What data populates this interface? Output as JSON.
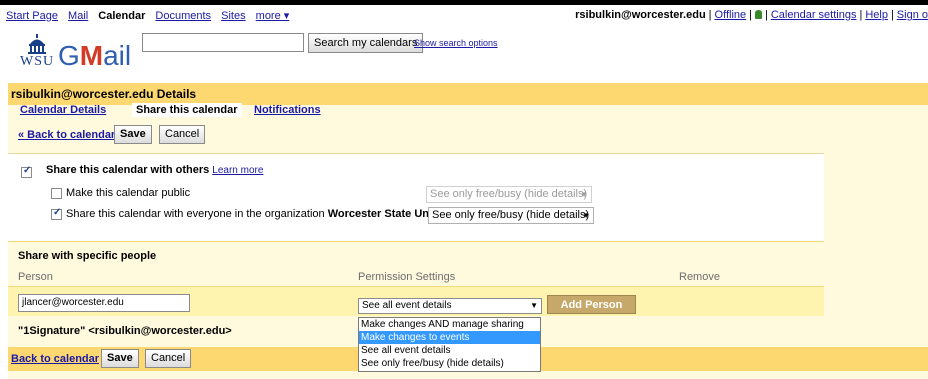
{
  "nav": {
    "items": [
      "Start Page",
      "Mail",
      "Calendar",
      "Documents",
      "Sites",
      "more ▾"
    ],
    "user": "rsibulkin@worcester.edu",
    "offline": "Offline",
    "calendar_settings": "Calendar settings",
    "help": "Help",
    "sign_out": "Sign o"
  },
  "logo": {
    "wsu": "WSU",
    "gmail_g": "G",
    "gmail_m": "M",
    "gmail_rest": "ail"
  },
  "search": {
    "button": "Search my calendars",
    "options": "Show search options",
    "value": ""
  },
  "panel": {
    "title": "rsibulkin@worcester.edu Details",
    "tabs": [
      "Calendar Details",
      "Share this calendar",
      "Notifications"
    ],
    "back_link": "« Back to calendar",
    "save": "Save",
    "cancel": "Cancel"
  },
  "sharing": {
    "share_with_others": "Share this calendar with others",
    "learn_more": "Learn more",
    "make_public": "Make this calendar public",
    "public_select": "See only free/busy (hide details)",
    "org_label": "Share this calendar with everyone in the organization",
    "org_name": "Worcester State University",
    "org_select": "See only free/busy (hide details)"
  },
  "specific": {
    "title": "Share with specific people",
    "col_person": "Person",
    "col_permission": "Permission Settings",
    "col_remove": "Remove",
    "person_value": "jlancer@worcester.edu",
    "permission_value": "See all event details",
    "add_person": "Add Person",
    "owner": "\"1Signature\" <rsibulkin@worcester.edu>"
  },
  "dropdown_options": [
    "Make changes AND manage sharing",
    "Make changes to events",
    "See all event details",
    "See only free/busy (hide details)"
  ],
  "bottom": {
    "back_link": "Back to calendar",
    "save": "Save",
    "cancel": "Cancel"
  },
  "colors": {
    "title_bar": "#fdd76f",
    "panel_bg": "#fff9dd",
    "highlight": "#3399ff",
    "add_button": "#c6a86a"
  }
}
